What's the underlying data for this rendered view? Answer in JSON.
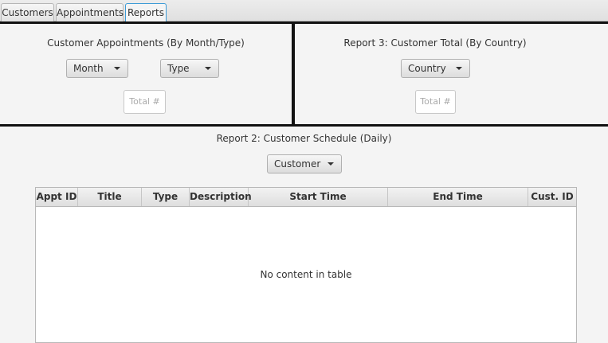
{
  "tabs": [
    {
      "label": "Customers"
    },
    {
      "label": "Appointments"
    },
    {
      "label": "Reports"
    }
  ],
  "report1": {
    "title": "Customer Appointments (By Month/Type)",
    "month_combo": "Month",
    "type_combo": "Type",
    "total_placeholder": "Total #"
  },
  "report3": {
    "title": "Report 3: Customer Total (By Country)",
    "country_combo": "Country",
    "total_placeholder": "Total #"
  },
  "report2": {
    "title": "Report 2: Customer Schedule (Daily)",
    "customer_combo": "Customer",
    "columns": [
      "Appt ID",
      "Title",
      "Type",
      "Description",
      "Start Time",
      "End Time",
      "Cust. ID"
    ],
    "empty_message": "No content in table"
  }
}
